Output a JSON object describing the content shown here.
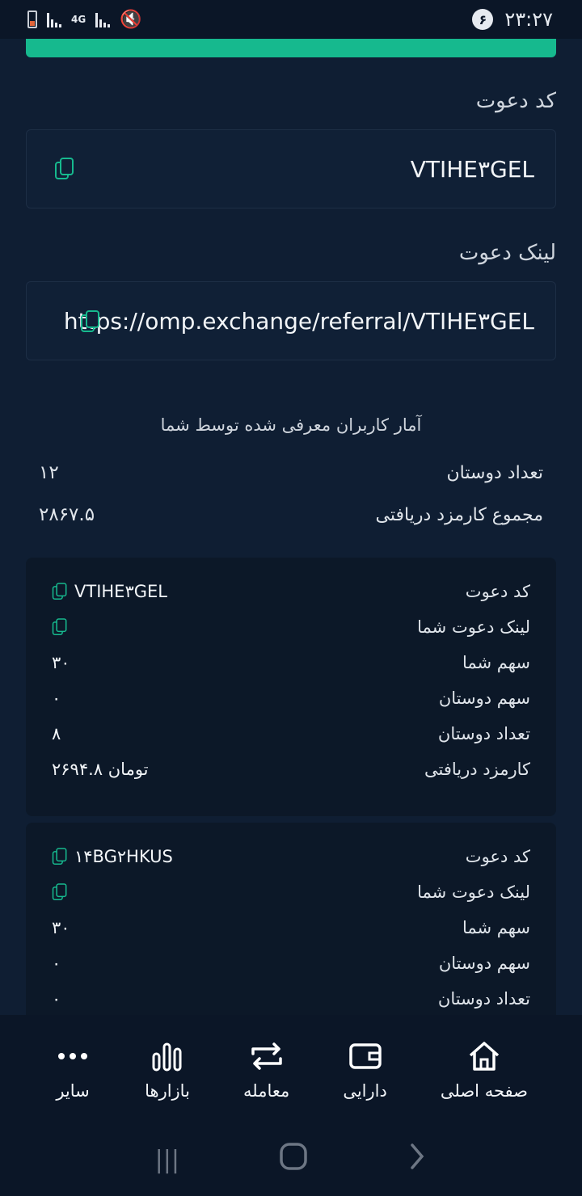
{
  "status": {
    "time": "۲۳:۲۷",
    "notification_count": "۶",
    "network_label": "4G"
  },
  "invite": {
    "code_label": "کد دعوت",
    "code_value": "VTIHE۳GEL",
    "link_label": "لینک دعوت",
    "link_value": "https://omp.exchange/referral/VTIHE۳GEL"
  },
  "stats": {
    "title": "آمار کاربران معرفی شده توسط شما",
    "friends_count_label": "تعداد دوستان",
    "friends_count_value": "۱۲",
    "total_fee_label": "مجموع کارمزد دریافتی",
    "total_fee_value": "۲۸۶۷.۵"
  },
  "cards": [
    {
      "code_label": "کد دعوت",
      "code_value": "VTIHE۳GEL",
      "link_label": "لینک دعوت شما",
      "share_label": "سهم شما",
      "share_value": "۳۰",
      "friends_share_label": "سهم دوستان",
      "friends_share_value": "۰",
      "friends_count_label": "تعداد دوستان",
      "friends_count_value": "۸",
      "fee_label": "کارمزد دریافتی",
      "fee_value": "۲۶۹۴.۸ تومان"
    },
    {
      "code_label": "کد دعوت",
      "code_value": "۱۴BG۲HKUS",
      "link_label": "لینک دعوت شما",
      "share_label": "سهم شما",
      "share_value": "۳۰",
      "friends_share_label": "سهم دوستان",
      "friends_share_value": "۰",
      "friends_count_label": "تعداد دوستان",
      "friends_count_value": "۰"
    }
  ],
  "nav": {
    "home": "صفحه اصلی",
    "assets": "دارایی",
    "trade": "معامله",
    "markets": "بازارها",
    "more": "سایر"
  },
  "colors": {
    "accent": "#16b98e",
    "background": "#0f1e33",
    "card": "#0c1828"
  }
}
